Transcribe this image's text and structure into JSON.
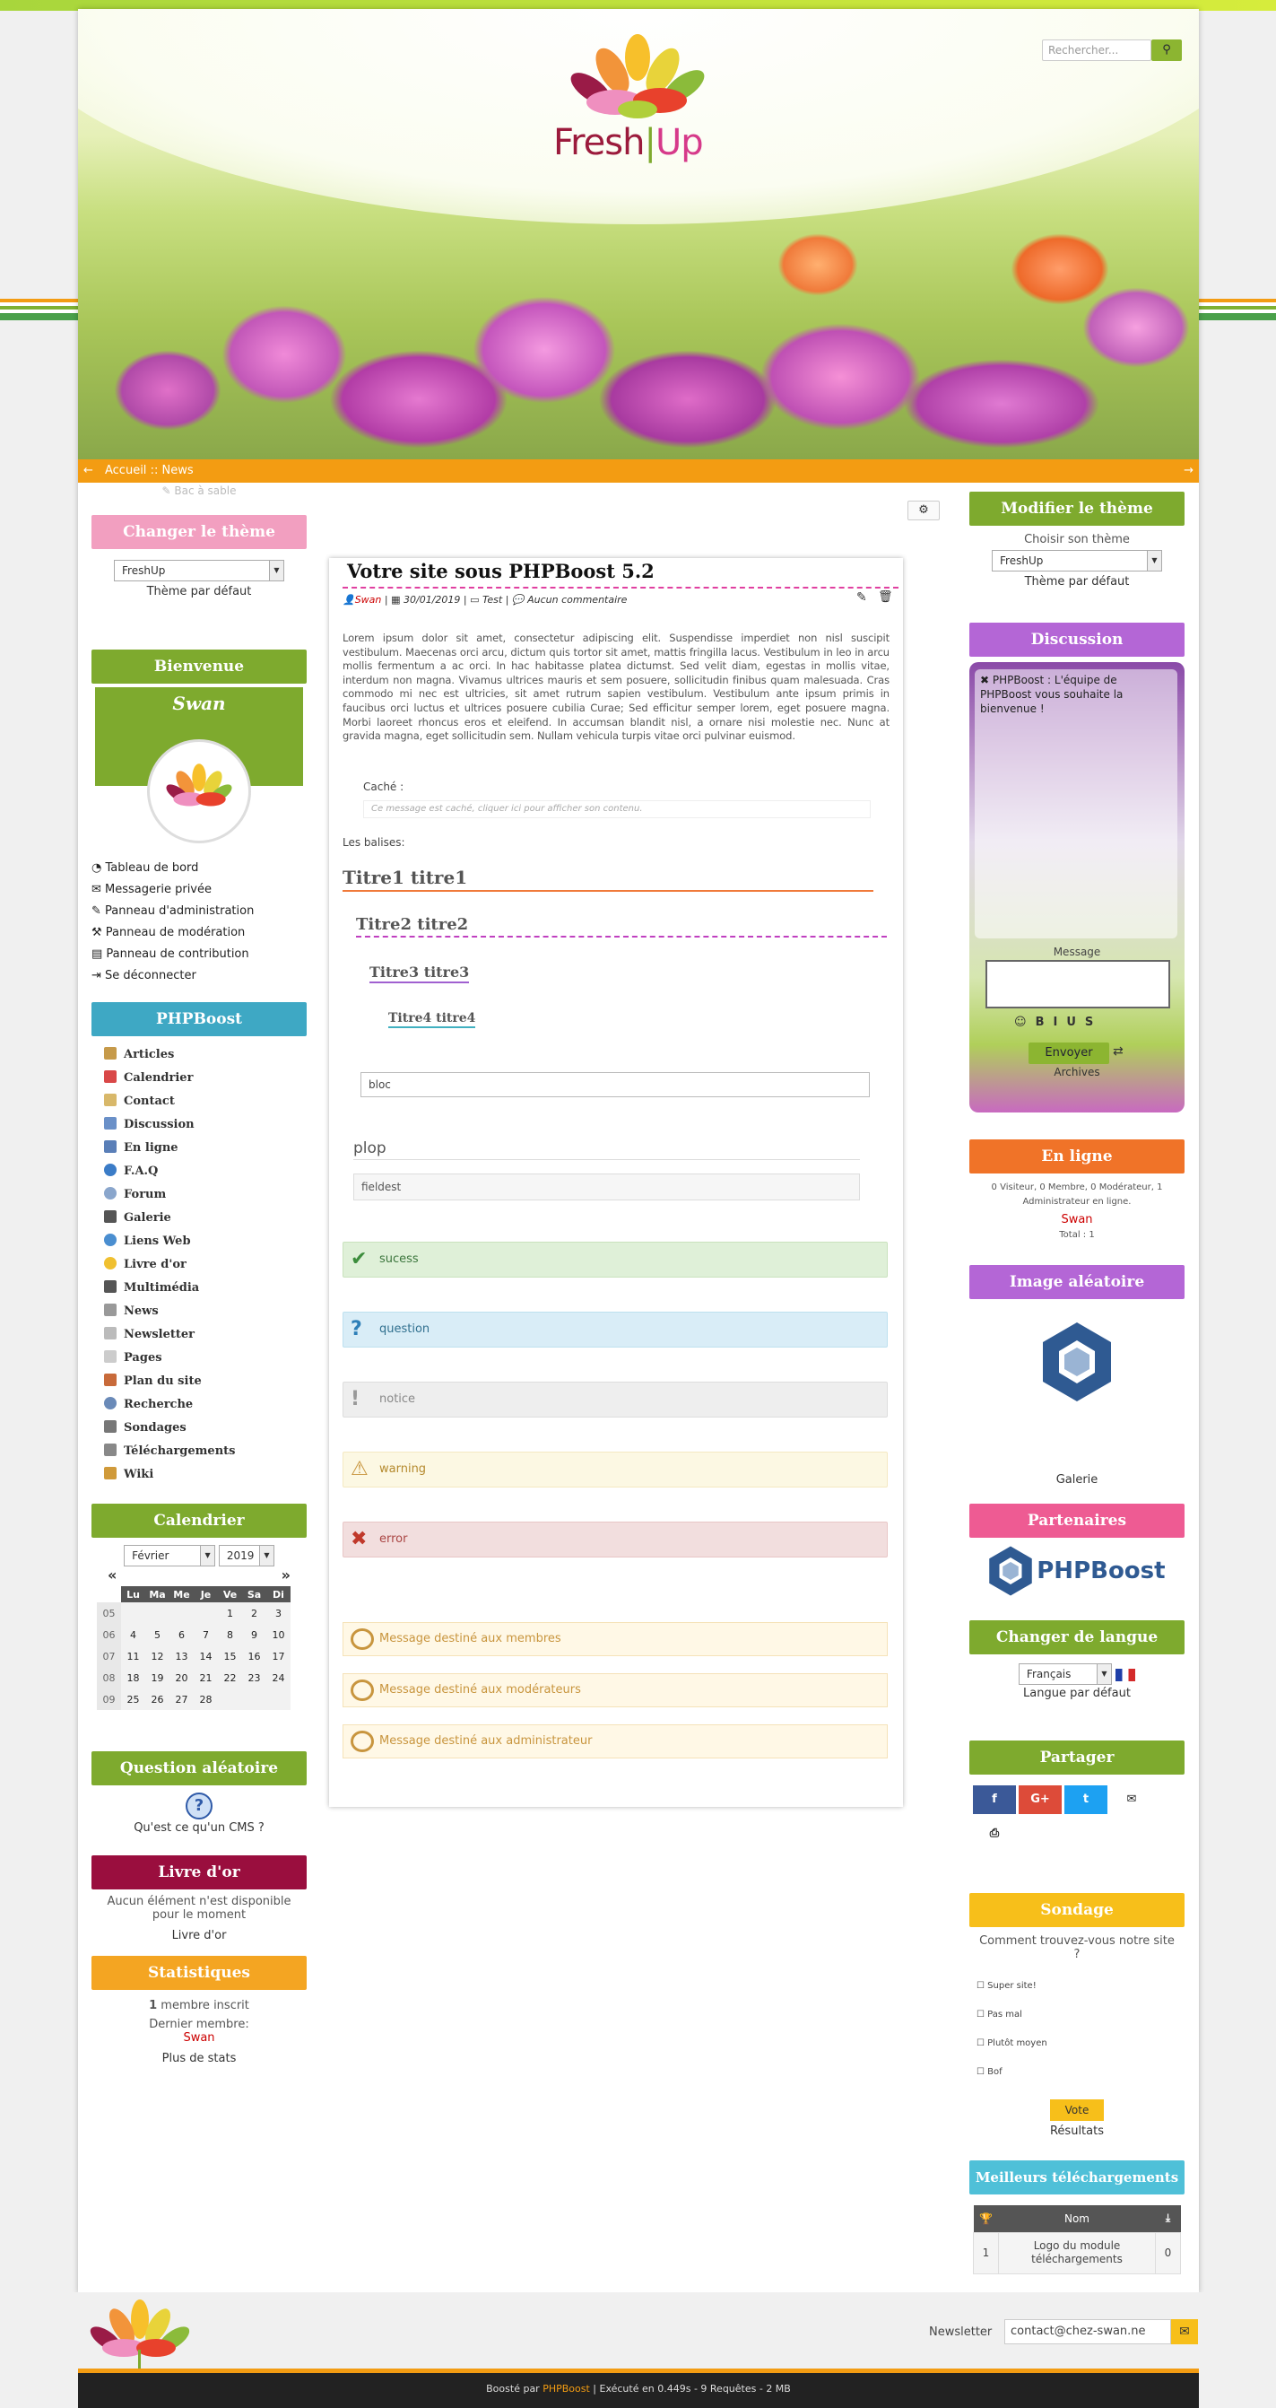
{
  "header": {
    "logo_text_1": "Fresh",
    "logo_text_2": "Up",
    "search_placeholder": "Rechercher..."
  },
  "breadcrumb": {
    "home": "Accueil",
    "sep": "::",
    "current": "News"
  },
  "sandbox_link": "Bac à sable",
  "left": {
    "theme": {
      "title": "Changer le thème",
      "selected": "FreshUp",
      "note": "Thème par défaut"
    },
    "welcome": {
      "title": "Bienvenue",
      "username": "Swan",
      "links": [
        "Tableau de bord",
        "Messagerie privée",
        "Panneau d'administration",
        "Panneau de modération",
        "Panneau de contribution",
        "Se déconnecter"
      ]
    },
    "phpboost": {
      "title": "PHPBoost",
      "items": [
        "Articles",
        "Calendrier",
        "Contact",
        "Discussion",
        "En ligne",
        "F.A.Q",
        "Forum",
        "Galerie",
        "Liens Web",
        "Livre d'or",
        "Multimédia",
        "News",
        "Newsletter",
        "Pages",
        "Plan du site",
        "Recherche",
        "Sondages",
        "Téléchargements",
        "Wiki"
      ]
    },
    "calendar": {
      "title": "Calendrier",
      "month": "Février",
      "year": "2019",
      "prev": "«",
      "next": "»",
      "days": [
        "Lu",
        "Ma",
        "Me",
        "Je",
        "Ve",
        "Sa",
        "Di"
      ],
      "weeks": [
        {
          "w": "05",
          "d": [
            "",
            "",
            "",
            "",
            "1",
            "2",
            "3"
          ]
        },
        {
          "w": "06",
          "d": [
            "4",
            "5",
            "6",
            "7",
            "8",
            "9",
            "10"
          ]
        },
        {
          "w": "07",
          "d": [
            "11",
            "12",
            "13",
            "14",
            "15",
            "16",
            "17"
          ]
        },
        {
          "w": "08",
          "d": [
            "18",
            "19",
            "20",
            "21",
            "22",
            "23",
            "24"
          ]
        },
        {
          "w": "09",
          "d": [
            "25",
            "26",
            "27",
            "28",
            "",
            "",
            ""
          ]
        }
      ]
    },
    "question": {
      "title": "Question aléatoire",
      "text": "Qu'est ce qu'un CMS ?"
    },
    "guestbook": {
      "title": "Livre d'or",
      "text": "Aucun élément n'est disponible pour le moment",
      "link": "Livre d'or"
    },
    "stats": {
      "title": "Statistiques",
      "count": "1",
      "count_label": "membre inscrit",
      "last_label": "Dernier membre:",
      "last_member": "Swan",
      "more": "Plus de stats"
    }
  },
  "main": {
    "title": "Votre site sous PHPBoost 5.2",
    "author": "Swan",
    "date": "30/01/2019",
    "category": "Test",
    "comments": "Aucun commentaire",
    "body": "Lorem ipsum dolor sit amet, consectetur adipiscing elit. Suspendisse imperdiet non nisl suscipit vestibulum. Maecenas orci arcu, dictum quis tortor sit amet, mattis fringilla lacus. Vestibulum in leo in arcu mollis fermentum a ac orci. In hac habitasse platea dictumst. Sed velit diam, egestas in mollis vitae, interdum non magna. Vivamus ultrices mauris et sem posuere, sollicitudin finibus quam malesuada. Cras commodo mi nec est ultricies, sit amet rutrum sapien vestibulum. Vestibulum ante ipsum primis in faucibus orci luctus et ultrices posuere cubilia Curae; Sed efficitur semper lorem, eget posuere magna. Morbi laoreet rhoncus eros et eleifend. In accumsan blandit nisl, a ornare nisi molestie nec. Nunc at gravida magna, eget sollicitudin sem. Nullam vehicula turpis vitae orci pulvinar euismod.",
    "hidden_label": "Caché :",
    "hidden_text": "Ce message est caché, cliquer ici pour afficher son contenu.",
    "tags_label": "Les balises:",
    "h1": "Titre1 titre1",
    "h2": "Titre2 titre2",
    "h3": "Titre3 titre3",
    "h4": "Titre4 titre4",
    "bloc": "bloc",
    "fieldset_legend": "plop",
    "fieldset_content": "fieldest",
    "alerts": {
      "success": "sucess",
      "question": "question",
      "notice": "notice",
      "warning": "warning",
      "error": "error"
    },
    "member_msgs": [
      "Message destiné aux membres",
      "Message destiné aux modérateurs",
      "Message destiné aux administrateur"
    ]
  },
  "right": {
    "theme": {
      "title": "Modifier le thème",
      "label": "Choisir son thème",
      "selected": "FreshUp",
      "note": "Thème par défaut"
    },
    "chat": {
      "title": "Discussion",
      "message": "PHPBoost : L'équipe de PHPBoost vous souhaite la bienvenue !",
      "msg_label": "Message",
      "send": "Envoyer",
      "archives": "Archives"
    },
    "online": {
      "title": "En ligne",
      "text": "0 Visiteur, 0 Membre, 0 Modérateur, 1 Administrateur en ligne.",
      "user": "Swan",
      "total": "Total : 1"
    },
    "image": {
      "title": "Image aléatoire",
      "caption": "Galerie"
    },
    "partners": {
      "title": "Partenaires",
      "logo": "PHPBoost"
    },
    "language": {
      "title": "Changer de langue",
      "selected": "Français",
      "note": "Langue par défaut"
    },
    "share": {
      "title": "Partager",
      "buttons": [
        "f",
        "G+",
        "t",
        "✉",
        "⎙"
      ]
    },
    "poll": {
      "title": "Sondage",
      "question": "Comment trouvez-vous notre site ?",
      "options": [
        "Super site!",
        "Pas mal",
        "Plutôt moyen",
        "Bof"
      ],
      "vote": "Vote",
      "results": "Résultats"
    },
    "downloads": {
      "title": "Meilleurs téléchargements",
      "col_name": "Nom",
      "rank": "1",
      "name": "Logo du module téléchargements",
      "count": "0"
    }
  },
  "footer": {
    "newsletter_label": "Newsletter",
    "newsletter_value": "contact@chez-swan.ne",
    "credits_prefix": "Boosté par",
    "credits_link": "PHPBoost",
    "credits_rest": "| Exécuté en 0.449s - 9 Requêtes - 2 MB"
  },
  "colors": {
    "orange": "#f39c12",
    "green": "#7eaa2e",
    "pink": "#f29fc0",
    "purple": "#b466d6",
    "teal": "#3ea8c4",
    "crimson": "#9a0e3e"
  }
}
